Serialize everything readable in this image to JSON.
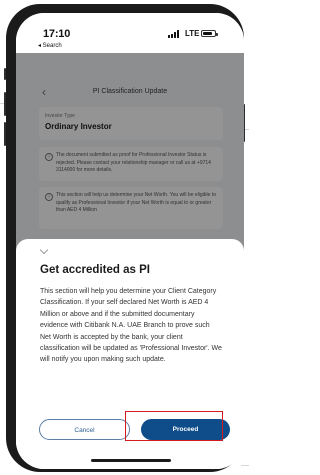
{
  "status_bar": {
    "time": "17:10",
    "back_app": "◂ Search",
    "network": "LTE"
  },
  "page": {
    "back_label": "‹",
    "title": "PI Classification Update",
    "investor_type_label": "Investor Type",
    "investor_type_value": "Ordinary Investor",
    "notice_text": "The document submitted as proof for Professional Investor Status is rejected. Please contact your relationship manager or call us at +9714 3114000 for more details.",
    "info_text": "This section will help us determine your Net Worth. You will be eligible to qualify as Professional Investor if your Net Worth is equal to or greater than AED 4 Million"
  },
  "sheet": {
    "title": "Get accredited as PI",
    "body": "This section will help you determine your Client Category Classification. If your self declared Net Worth is AED 4 Million or above and if the submitted documentary evidence with Citibank N.A. UAE Branch to prove such Net Worth is accepted by the bank, your client classification will be updated as 'Professional Investor'. We will notify you upon making such update.",
    "cancel_label": "Cancel",
    "proceed_label": "Proceed"
  },
  "colors": {
    "primary": "#0e4c8a",
    "highlight": "#d71920"
  }
}
